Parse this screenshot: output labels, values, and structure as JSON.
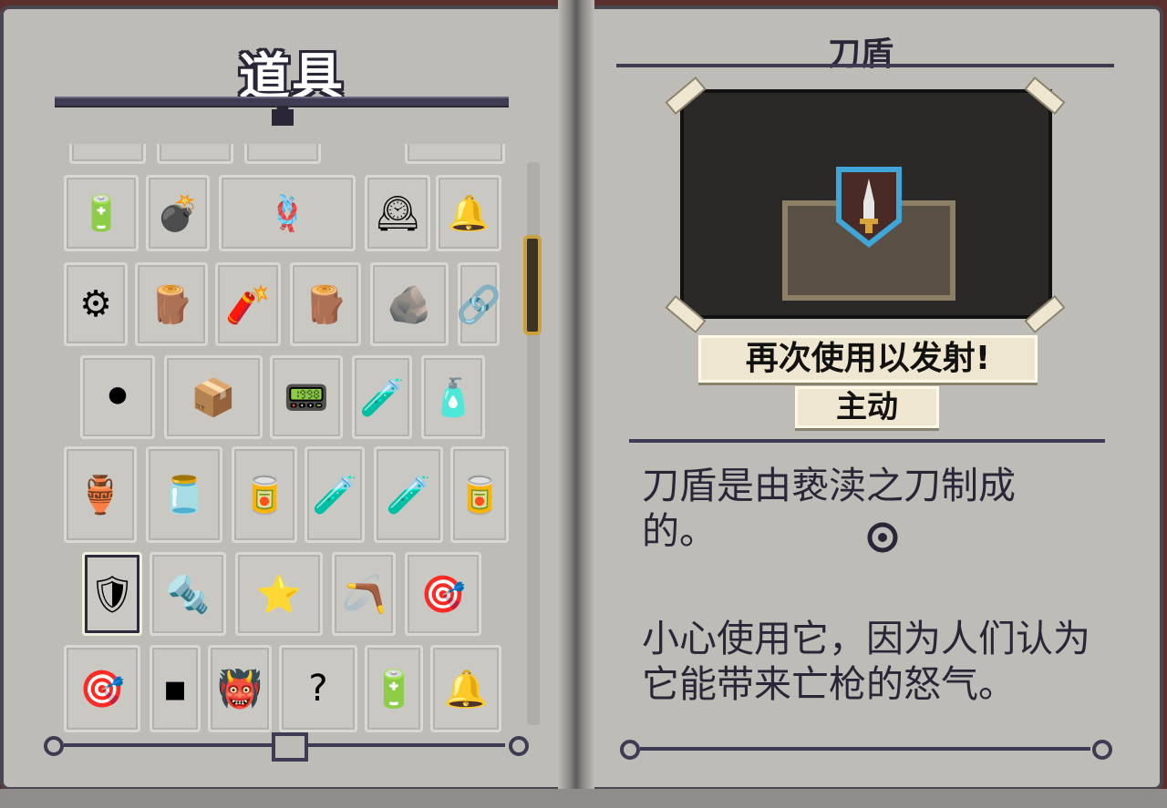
{
  "left_page": {
    "title": "道具"
  },
  "items": [
    {
      "name": "item-partial-1",
      "glyph": ""
    },
    {
      "name": "item-partial-2",
      "glyph": ""
    },
    {
      "name": "item-partial-3",
      "glyph": ""
    },
    {
      "name": "item-partial-4",
      "glyph": ""
    },
    {
      "name": "item-battery-icon",
      "glyph": "🔋"
    },
    {
      "name": "item-bomb-icon",
      "glyph": "💣"
    },
    {
      "name": "item-ammo-belt-icon",
      "glyph": "🪢"
    },
    {
      "name": "item-clock-icon",
      "glyph": "🕰"
    },
    {
      "name": "item-bell-jar-icon",
      "glyph": "🔔"
    },
    {
      "name": "item-gear-orb-icon",
      "glyph": "⚙"
    },
    {
      "name": "item-log-icon",
      "glyph": "🪵"
    },
    {
      "name": "item-dynamite-icon",
      "glyph": "🧨"
    },
    {
      "name": "item-stump-icon",
      "glyph": "🪵"
    },
    {
      "name": "item-boulder-icon",
      "glyph": "🪨"
    },
    {
      "name": "item-chain-icon",
      "glyph": "🔗"
    },
    {
      "name": "item-cannonballs-icon",
      "glyph": "⚫"
    },
    {
      "name": "item-crate-icon",
      "glyph": "📦"
    },
    {
      "name": "item-device-icon",
      "glyph": "📟"
    },
    {
      "name": "item-bottle-blue-icon",
      "glyph": "🧪"
    },
    {
      "name": "item-bottle-dark-icon",
      "glyph": "🧴"
    },
    {
      "name": "item-jug-icon",
      "glyph": "🏺"
    },
    {
      "name": "item-jar-icon",
      "glyph": "🫙"
    },
    {
      "name": "item-canister-icon",
      "glyph": "🥫"
    },
    {
      "name": "item-potion-green-icon",
      "glyph": "🧪"
    },
    {
      "name": "item-potion-red-icon",
      "glyph": "🧪"
    },
    {
      "name": "item-can-icon",
      "glyph": "🥫"
    },
    {
      "name": "item-blade-shield-icon",
      "glyph": "🛡"
    },
    {
      "name": "item-drill-icon",
      "glyph": "🔩"
    },
    {
      "name": "item-star-creature-icon",
      "glyph": "⭐"
    },
    {
      "name": "item-boomerang-icon",
      "glyph": "🪃"
    },
    {
      "name": "item-shield-round-icon",
      "glyph": "🎯"
    },
    {
      "name": "item-crosshair-orb-icon",
      "glyph": "🎯"
    },
    {
      "name": "item-chip-icon",
      "glyph": "▪"
    },
    {
      "name": "item-daruma-icon",
      "glyph": "👹"
    },
    {
      "name": "item-unknown-icon",
      "glyph": "?"
    },
    {
      "name": "item-plus-one-battery-icon",
      "glyph": "🔋"
    },
    {
      "name": "item-alarm-bell-icon",
      "glyph": "🔔"
    }
  ],
  "right_page": {
    "title": "刀盾",
    "banner": "再次使用以发射!",
    "type_tag": "主动",
    "description_1": "刀盾是由亵渎之刀制成的。",
    "description_2": "小心使用它，因为人们认为它能带来亡枪的怒气。"
  },
  "colors": {
    "page": "#bdbcb7",
    "ink": "#2a2638",
    "gold": "#c9a13d",
    "shield_frame": "#3fa6d8"
  }
}
